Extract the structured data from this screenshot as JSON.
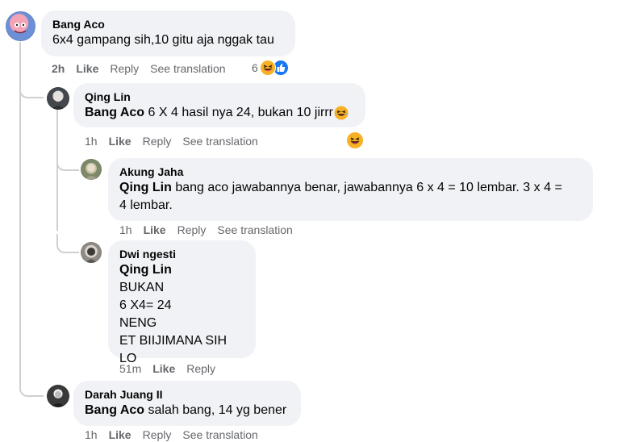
{
  "comments": [
    {
      "author": "Bang Aco",
      "text": "6x4 gampang sih,10 gitu aja nggak tau",
      "time": "2h",
      "like": "Like",
      "reply": "Reply",
      "translate": "See translation",
      "reaction_count": "6"
    },
    {
      "author": "Qing Lin",
      "mention": "Bang Aco",
      "text": "6 X 4 hasil nya 24, bukan 10 jirrr",
      "time": "1h",
      "like": "Like",
      "reply": "Reply",
      "translate": "See translation"
    },
    {
      "author": "Akung Jaha",
      "mention": "Qing Lin",
      "text_line1": "bang aco jawabannya benar, jawabannya 6 x 4 = 10 lembar. 3 x 4 =",
      "text_line2": "4 lembar.",
      "time": "1h",
      "like": "Like",
      "reply": "Reply",
      "translate": "See translation"
    },
    {
      "author": "Dwi ngesti",
      "mention": "Qing Lin",
      "lines": [
        "BUKAN",
        "6 X4= 24",
        "NENG",
        "ET BIIJIMANA SIH LO"
      ],
      "time": "51m",
      "like": "Like",
      "reply": "Reply"
    },
    {
      "author": "Darah Juang II",
      "mention": "Bang Aco",
      "text": "salah bang, 14 yg bener",
      "time": "1h",
      "like": "Like",
      "reply": "Reply",
      "translate": "See translation"
    }
  ],
  "colors": {
    "bubble": "#f0f2f5",
    "meta": "#65676b",
    "thread_line": "#ced0d4",
    "like_blue": "#1877f2",
    "haha_yellow": "#f7b125"
  },
  "icons": [
    "haha-reaction-icon",
    "like-reaction-icon"
  ]
}
